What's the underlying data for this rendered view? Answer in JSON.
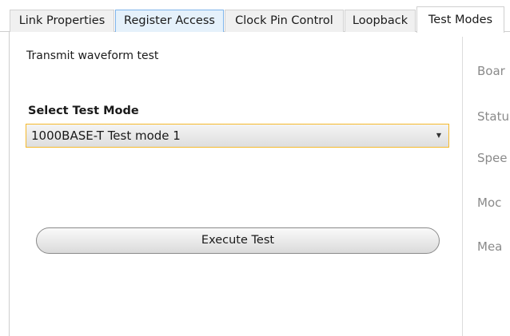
{
  "tabs": [
    {
      "label": "Link Properties"
    },
    {
      "label": "Register Access"
    },
    {
      "label": "Clock Pin Control"
    },
    {
      "label": "Loopback"
    },
    {
      "label": "Test Modes"
    }
  ],
  "main": {
    "title": "Transmit waveform test",
    "select_label": "Select Test Mode",
    "selected_mode": "1000BASE-T Test mode 1",
    "dropdown_icon": "chevron-down-icon",
    "execute_label": "Execute Test"
  },
  "side_panel": {
    "labels": [
      "Boar",
      "Statu",
      "Spee",
      "Moc",
      "Mea"
    ]
  },
  "colors": {
    "focus_border": "#f5b92c",
    "hover_tab_bg": "#e5f1fb",
    "hover_tab_border": "#7eb4ea",
    "muted_text": "#8a8a8a"
  }
}
